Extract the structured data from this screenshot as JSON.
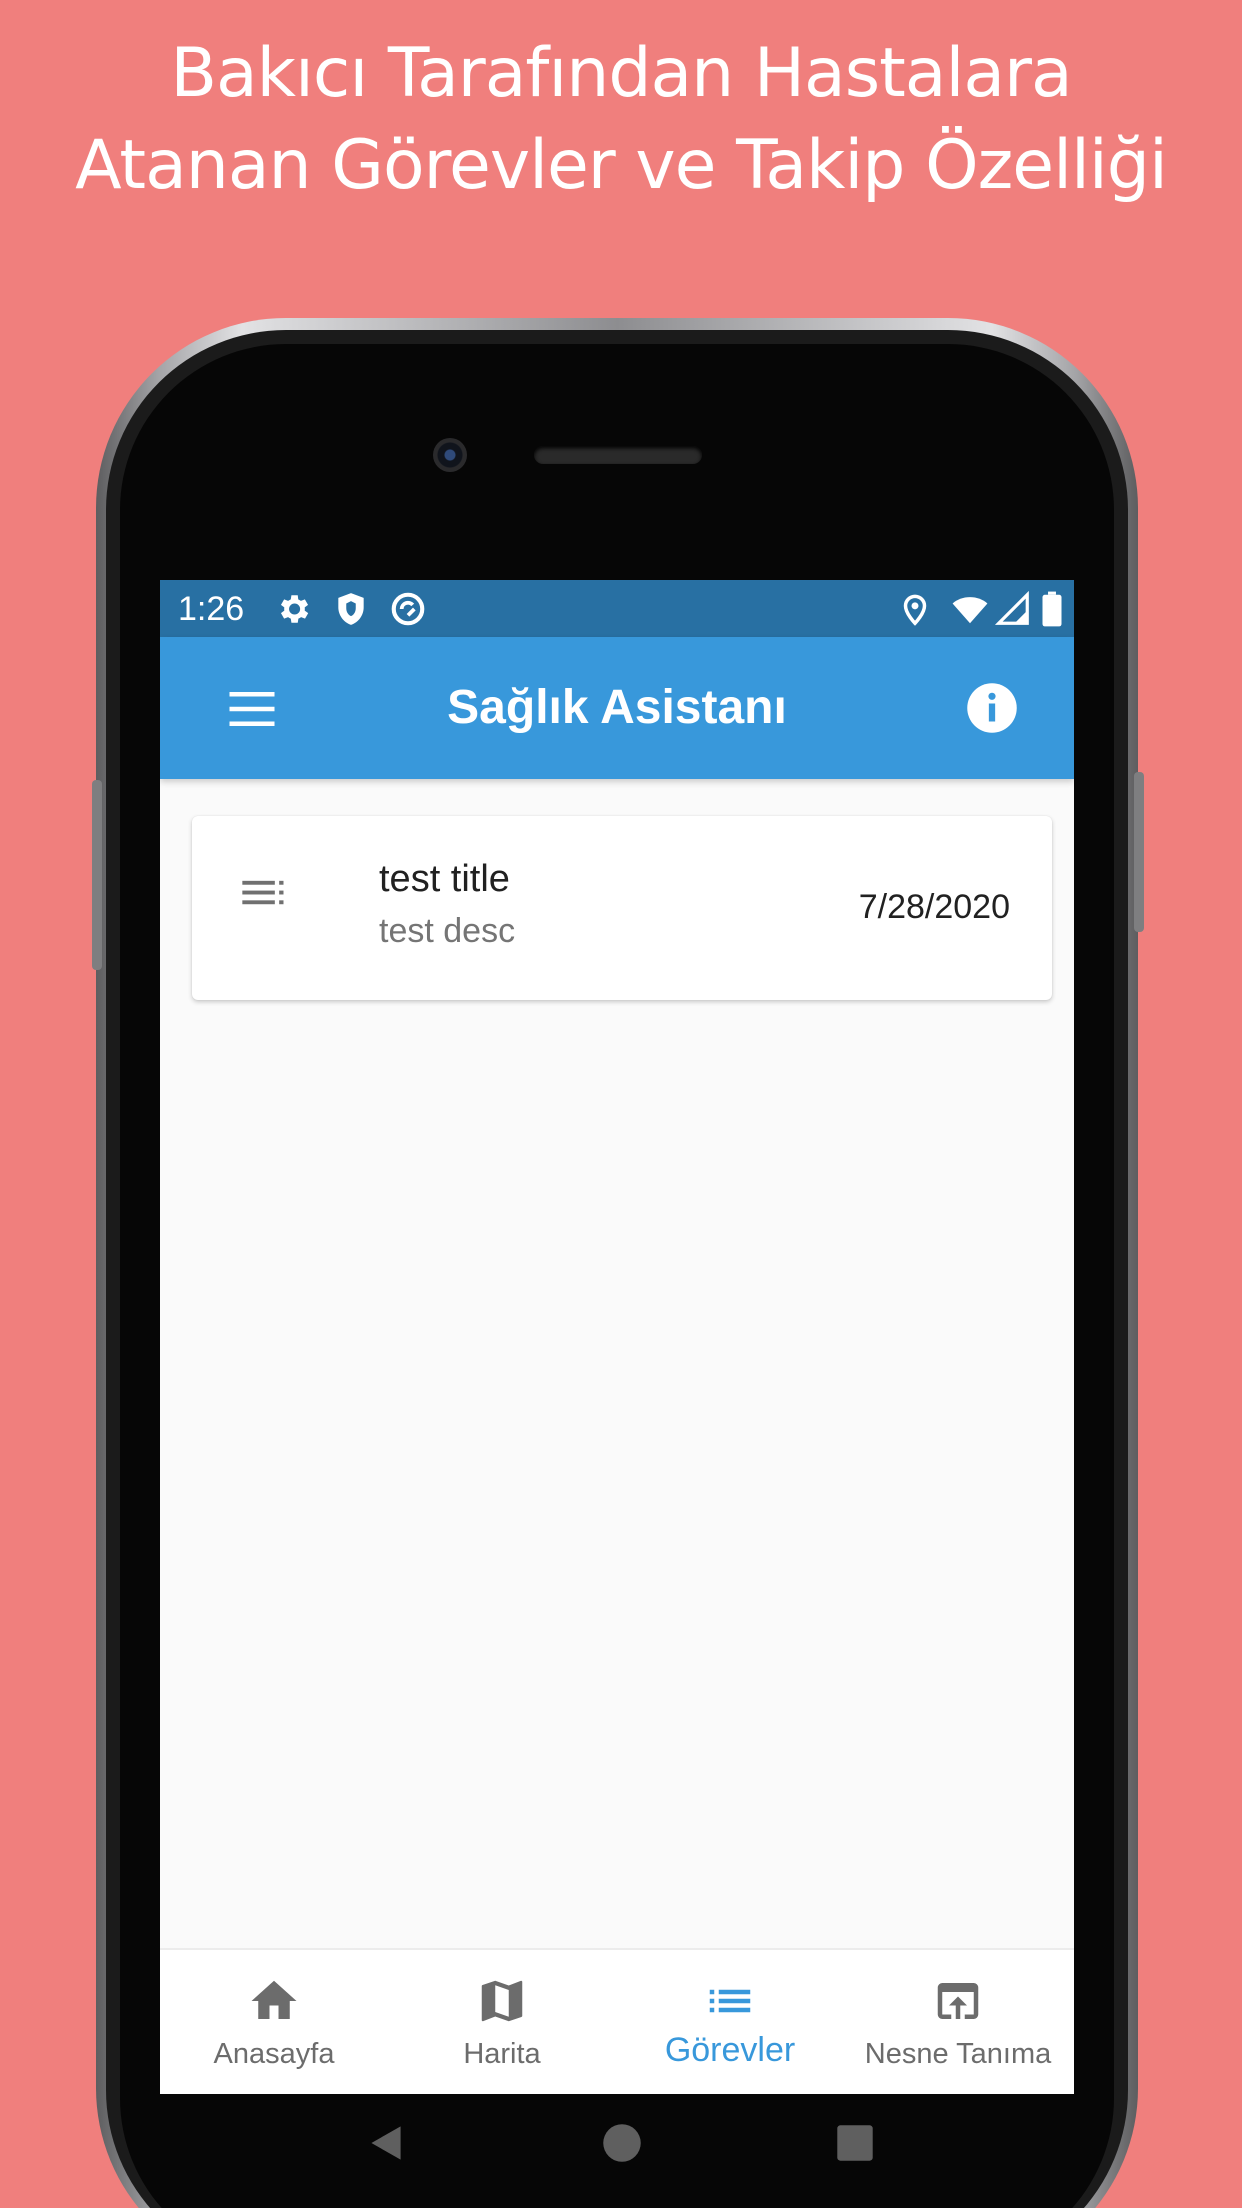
{
  "promo": {
    "line1": "Bakıcı Tarafından Hastalara",
    "line2": "Atanan Görevler ve Takip Özelliği"
  },
  "status_bar": {
    "time": "1:26",
    "icons": [
      "gear-icon",
      "shield-icon",
      "sync-icon",
      "location-icon",
      "wifi-icon",
      "signal-icon",
      "battery-icon"
    ]
  },
  "app_bar": {
    "title": "Sağlık Asistanı",
    "menu_icon": "hamburger-icon",
    "info_icon": "info-icon",
    "color": "#3898DB",
    "status_color": "#2870A3"
  },
  "tasks": [
    {
      "icon": "notes-icon",
      "title": "test title",
      "description": "test desc",
      "date": "7/28/2020"
    }
  ],
  "bottom_nav": {
    "active_index": 2,
    "active_color": "#3898DB",
    "items": [
      {
        "label": "Anasayfa",
        "icon": "home-icon"
      },
      {
        "label": "Harita",
        "icon": "map-icon"
      },
      {
        "label": "Görevler",
        "icon": "list-icon"
      },
      {
        "label": "Nesne Tanıma",
        "icon": "open-in-browser-icon"
      }
    ]
  },
  "system_nav": [
    "back-icon",
    "home-circle-icon",
    "recents-square-icon"
  ]
}
